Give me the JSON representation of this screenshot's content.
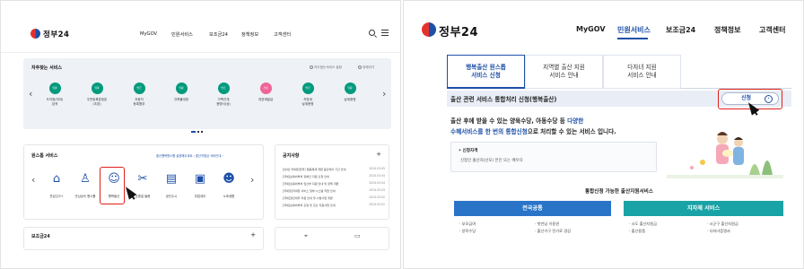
{
  "left": {
    "logo_text": "정부24",
    "nav": [
      "MyGOV",
      "민원서비스",
      "보조금24",
      "정책정보",
      "고객센터"
    ],
    "favorites": {
      "title": "자주찾는 서비스",
      "opt_set": "자주찾는서비스 설정",
      "opt_more": "뒤에이기",
      "items": [
        {
          "badge": "열람",
          "label": "도지정(미아)\n검색",
          "color": "green"
        },
        {
          "badge": "열람",
          "label": "주민등록표등본\n(초본)",
          "color": "green"
        },
        {
          "badge": "발급",
          "label": "자동차\n등록원부",
          "color": "green"
        },
        {
          "badge": "열람",
          "label": "건축물대장",
          "color": "green"
        },
        {
          "badge": "발급",
          "label": "가족관계\n증명서(상)",
          "color": "green"
        },
        {
          "badge": "신청",
          "label": "여권재발급",
          "color": "pink"
        },
        {
          "badge": "발급",
          "label": "지방세\n납세증명",
          "color": "green"
        },
        {
          "badge": "열람",
          "label": "납세증명",
          "color": "green"
        }
      ]
    },
    "services": {
      "title": "원스톱 서비스",
      "links": "출산행복원스톱 설정해주세요 ›   출산지원금 국비안내 ›",
      "items": [
        {
          "icon": "house-icon",
          "glyph": "⌂",
          "label": "전입신고+"
        },
        {
          "icon": "person-icon",
          "glyph": "♙",
          "label": "안심상속 원스톱"
        },
        {
          "icon": "baby-icon",
          "glyph": "☺",
          "label": "행복출산"
        },
        {
          "icon": "scissors-icon",
          "glyph": "✂",
          "label": "온종일 돌봄"
        },
        {
          "icon": "book-icon",
          "glyph": "▤",
          "label": "공인수시"
        },
        {
          "icon": "briefcase-icon",
          "glyph": "▣",
          "label": "취업세무"
        },
        {
          "icon": "elder-icon",
          "glyph": "☻",
          "label": "노후생활"
        }
      ]
    },
    "notices": {
      "title": "공지사항",
      "rows": [
        {
          "text": "[안내] 국세청(한국) 협동체계 개편 중단되어 기간 안내",
          "date": "2024.03.05"
        },
        {
          "text": "[국세]보육비부처 장애인 지원 신청 안내",
          "date": "2024.03.04"
        },
        {
          "text": "[국세]보육비부처 임신부 지원 안내 및 정책 개편",
          "date": "2024.03.04"
        },
        {
          "text": "[국세청]국세청 서비스 일부 시스템 작업 안내",
          "date": "2024.03.03"
        },
        {
          "text": "[국세]청년세무 지원 안내 및 시범사업 개편",
          "date": "2024.03.02"
        },
        {
          "text": "[국세]보육비부처 출생 및 출산 지원사업 안내",
          "date": "2024.03.01"
        }
      ]
    },
    "bottom_title": "보조금24"
  },
  "right": {
    "logo_text": "정부24",
    "nav": [
      "MyGOV",
      "민원서비스",
      "보조금24",
      "정책정보",
      "고객센터"
    ],
    "tabs": [
      {
        "label": "행복출산 원스톱\n서비스 신청"
      },
      {
        "label": "지역별 출산 지원\n서비스 안내"
      },
      {
        "label": "다자녀 지원\n서비스 안내"
      }
    ],
    "bar_title": "출산 관련 서비스 통합처리 신청(행복출산)",
    "apply_label": "신청",
    "desc_line1_a": "출산 후에 받을 수 있는 양육수당, 아동수당 등 ",
    "desc_line1_b": "다양한",
    "desc_line2_a": "수혜서비스를 한 번의 통합신청",
    "desc_line2_b": "으로 처리할 수 있는 서비스 입니다.",
    "box_heading": "• 신청자격",
    "box_text": "신청인 출산자(산모) 본인 또는 배우자",
    "section_title": "통합신청 가능한 출산지원서비스",
    "col1_title": "전국공통",
    "col2_title": "지자체 서비스",
    "col1_items": [
      "· 부모급여",
      "· 양육수당",
      "· 첫만남 이용권",
      "· 출산가구 전기료 경감"
    ],
    "col2_items": [
      "· 시도 출산지원금",
      "· 출산용품",
      "· 시군구 출산지원금",
      "· 다자녀증명서"
    ]
  }
}
